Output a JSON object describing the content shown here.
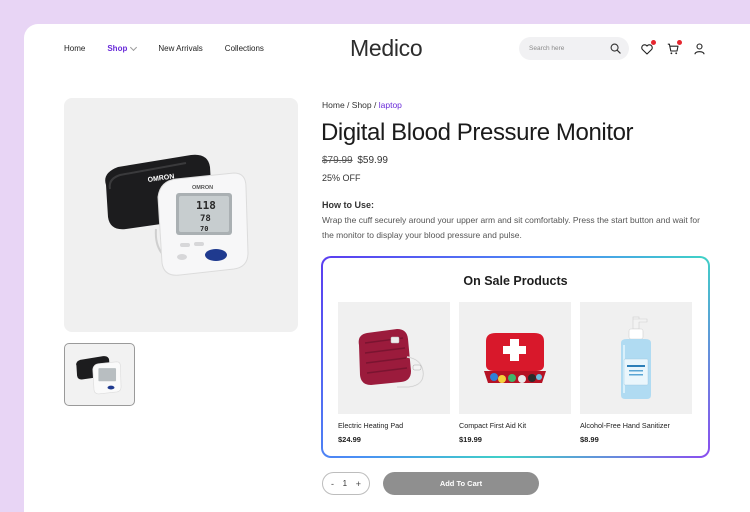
{
  "nav": {
    "items": [
      {
        "label": "Home"
      },
      {
        "label": "Shop"
      },
      {
        "label": "New Arrivals"
      },
      {
        "label": "Collections"
      }
    ]
  },
  "brand": {
    "logo": "Medico"
  },
  "search": {
    "placeholder": "Search here"
  },
  "header_icons": [
    "wishlist-heart-icon",
    "cart-icon",
    "user-icon"
  ],
  "colors": {
    "accent": "#6a2bd9",
    "badge": "#e5262f",
    "add_button": "#8f8f8f"
  },
  "breadcrumb": {
    "home": "Home",
    "sep1": " / ",
    "shop": "Shop",
    "sep2": " / ",
    "current": "laptop"
  },
  "product": {
    "title": "Digital Blood Pressure Monitor",
    "old_price": "$79.99",
    "price": "$59.99",
    "discount": "25% OFF",
    "howto_heading": "How to Use:",
    "howto_text": "Wrap the cuff securely around your upper arm and sit comfortably. Press the start button and wait for the monitor to display your blood pressure and pulse.",
    "image": {
      "brand": "OMRON",
      "readings": [
        "118",
        "78",
        "70"
      ]
    }
  },
  "on_sale": {
    "title": "On Sale Products",
    "items": [
      {
        "name": "Electric Heating Pad",
        "price": "$24.99"
      },
      {
        "name": "Compact First Aid Kit",
        "price": "$19.99"
      },
      {
        "name": "Alcohol-Free Hand Sanitizer",
        "price": "$8.99"
      }
    ]
  },
  "cart": {
    "minus": "-",
    "quantity": "1",
    "plus": "+",
    "add_label": "Add To Cart"
  }
}
